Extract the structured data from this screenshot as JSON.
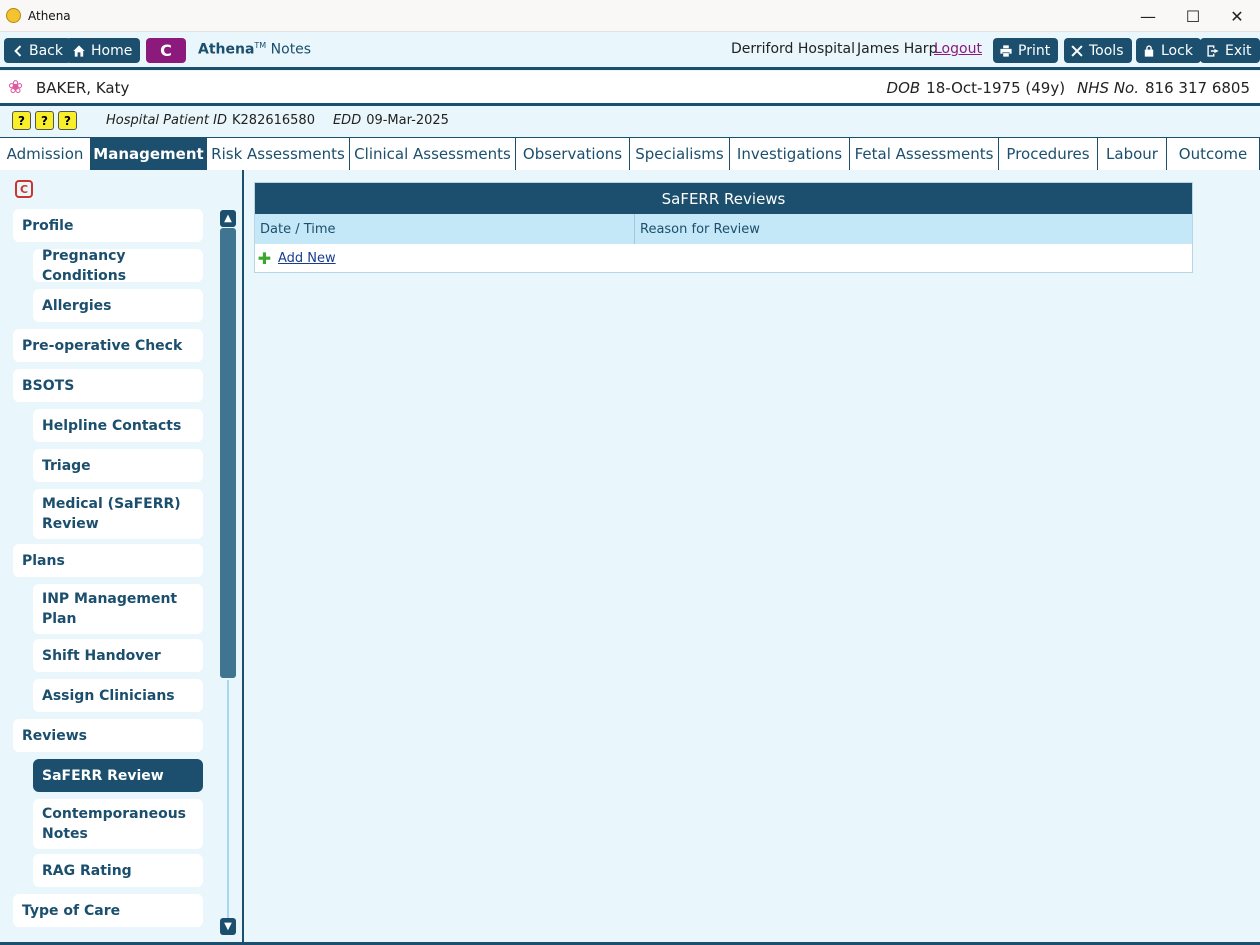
{
  "window": {
    "title": "Athena"
  },
  "toolbar": {
    "back": "Back",
    "home": "Home",
    "c_label": "C",
    "app_name": "Athena",
    "app_tm": "TM",
    "app_suffix": "Notes",
    "hospital": "Derriford Hospital",
    "user": "James Harp",
    "logout": "Logout",
    "print": "Print",
    "tools": "Tools",
    "lock": "Lock",
    "exit": "Exit"
  },
  "patient": {
    "name": "BAKER, Katy",
    "dob_label": "DOB",
    "dob": "18-Oct-1975 (49y)",
    "nhs_label": "NHS No.",
    "nhs": "816 317 6805",
    "hospital_id_label": "Hospital Patient ID",
    "hospital_id": "K282616580",
    "edd_label": "EDD",
    "edd": "09-Mar-2025"
  },
  "tabs": [
    "Admission",
    "Management",
    "Risk Assessments",
    "Clinical Assessments",
    "Observations",
    "Specialisms",
    "Investigations",
    "Fetal Assessments",
    "Procedures",
    "Labour",
    "Outcome"
  ],
  "active_tab": "Management",
  "sidebar": {
    "c_icon": "C",
    "items": [
      {
        "label": "Profile"
      },
      {
        "label": "Pregnancy Conditions"
      },
      {
        "label": "Allergies"
      },
      {
        "label": "Pre-operative Check"
      },
      {
        "label": "BSOTS"
      },
      {
        "label": "Helpline Contacts"
      },
      {
        "label": "Triage"
      },
      {
        "label": "Medical (SaFERR) Review"
      },
      {
        "label": "Plans"
      },
      {
        "label": "INP Management Plan"
      },
      {
        "label": "Shift Handover"
      },
      {
        "label": "Assign Clinicians"
      },
      {
        "label": "Reviews"
      },
      {
        "label": "SaFERR Review"
      },
      {
        "label": "Contemporaneous Notes"
      },
      {
        "label": "RAG Rating"
      },
      {
        "label": "Type of Care"
      }
    ]
  },
  "panel": {
    "title": "SaFERR Reviews",
    "columns": [
      "Date / Time",
      "Reason for Review"
    ],
    "add_new": "Add New"
  },
  "colors": {
    "primary": "#1b4f6d",
    "accent": "#8c1a7c",
    "background": "#e9f6fb"
  }
}
